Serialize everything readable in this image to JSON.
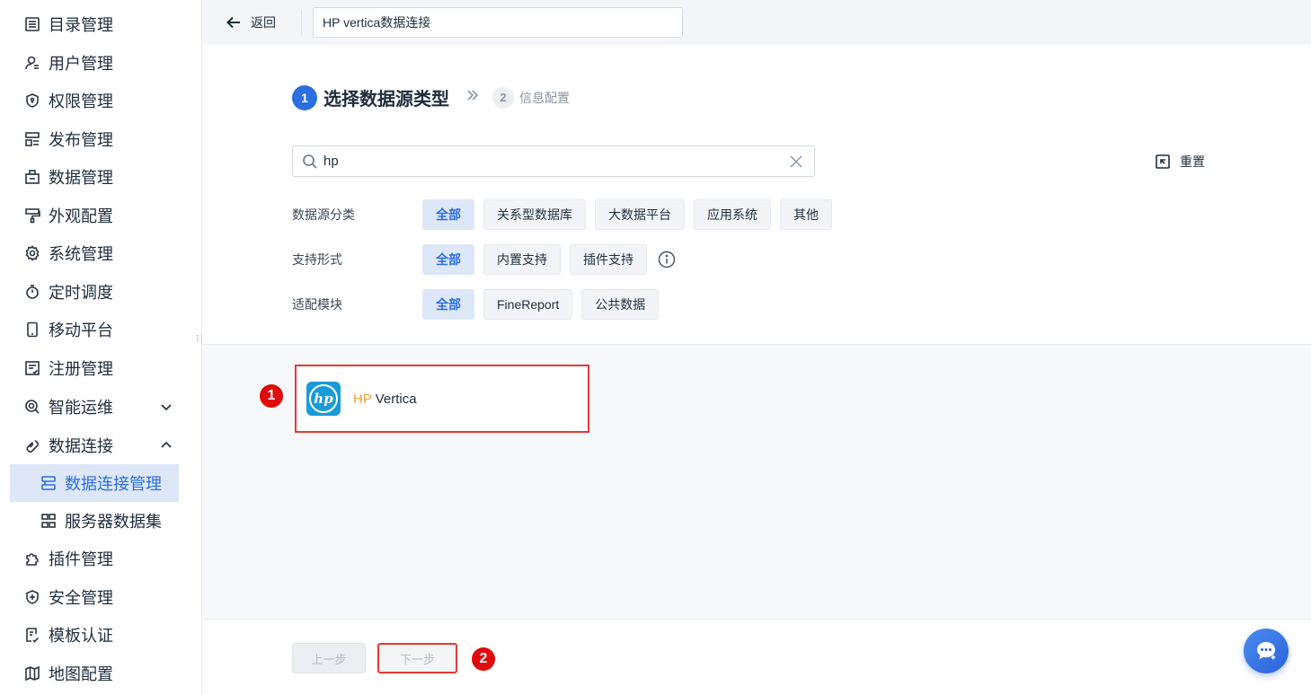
{
  "sidebar": {
    "items": [
      {
        "label": "目录管理",
        "icon": "list-icon"
      },
      {
        "label": "用户管理",
        "icon": "user-icon"
      },
      {
        "label": "权限管理",
        "icon": "shield-icon"
      },
      {
        "label": "发布管理",
        "icon": "layout-icon"
      },
      {
        "label": "数据管理",
        "icon": "database-icon"
      },
      {
        "label": "外观配置",
        "icon": "paint-icon"
      },
      {
        "label": "系统管理",
        "icon": "gear-icon"
      },
      {
        "label": "定时调度",
        "icon": "timer-icon"
      },
      {
        "label": "移动平台",
        "icon": "mobile-icon"
      },
      {
        "label": "注册管理",
        "icon": "register-icon"
      },
      {
        "label": "智能运维",
        "icon": "ops-icon"
      },
      {
        "label": "数据连接",
        "icon": "link-icon"
      },
      {
        "label": "数据连接管理",
        "icon": "connection-icon"
      },
      {
        "label": "服务器数据集",
        "icon": "server-dataset-icon"
      },
      {
        "label": "插件管理",
        "icon": "plugin-icon"
      },
      {
        "label": "安全管理",
        "icon": "security-icon"
      },
      {
        "label": "模板认证",
        "icon": "template-icon"
      },
      {
        "label": "地图配置",
        "icon": "map-icon"
      }
    ]
  },
  "topbar": {
    "back_label": "返回",
    "connection_name": "HP vertica数据连接"
  },
  "steps": {
    "step1_num": "1",
    "step1_title": "选择数据源类型",
    "step2_num": "2",
    "step2_title": "信息配置"
  },
  "search": {
    "value": "hp",
    "reset_label": "重置"
  },
  "filters": {
    "category": {
      "label": "数据源分类",
      "options": [
        "全部",
        "关系型数据库",
        "大数据平台",
        "应用系统",
        "其他"
      ]
    },
    "support": {
      "label": "支持形式",
      "options": [
        "全部",
        "内置支持",
        "插件支持"
      ]
    },
    "module": {
      "label": "适配模块",
      "options": [
        "全部",
        "FineReport",
        "公共数据"
      ]
    }
  },
  "result": {
    "highlight": "HP",
    "rest": " Vertica",
    "logo_text": "hp"
  },
  "annotations": {
    "badge1": "1",
    "badge2": "2"
  },
  "footer": {
    "prev_label": "上一步",
    "next_label": "下一步"
  },
  "colors": {
    "accent": "#2b6ee0",
    "highlight_red": "#e53935",
    "match_orange": "#e8a13a",
    "hp_blue": "#1a9ad6"
  }
}
